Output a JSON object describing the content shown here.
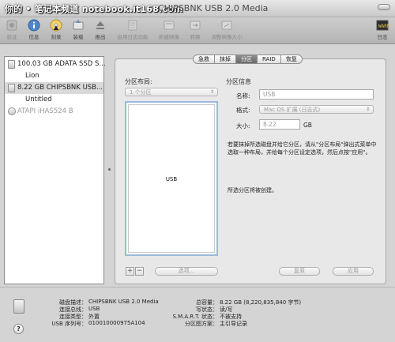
{
  "watermark": "你的 • 笔记本频道 notebook.it168.com",
  "window": {
    "title": "CHIPSBNK USB 2.0 Media"
  },
  "toolbar": {
    "items": [
      {
        "label": "验证",
        "icon": "verify-icon",
        "enabled": false
      },
      {
        "label": "信息",
        "icon": "info-icon",
        "enabled": true
      },
      {
        "label": "刻录",
        "icon": "burn-icon",
        "enabled": true
      },
      {
        "label": "装载",
        "icon": "mount-icon",
        "enabled": true
      },
      {
        "label": "推出",
        "icon": "eject-icon",
        "enabled": true
      },
      {
        "label": "启用日志功能",
        "icon": "journaling-icon",
        "enabled": false
      },
      {
        "label": "新建映像",
        "icon": "new-image-icon",
        "enabled": false
      },
      {
        "label": "转换",
        "icon": "convert-icon",
        "enabled": false
      },
      {
        "label": "调整映像大小",
        "icon": "resize-image-icon",
        "enabled": false
      }
    ],
    "log_label": "日志"
  },
  "sidebar": {
    "items": [
      {
        "label": "100.03 GB ADATA SSD S...",
        "type": "disk",
        "selected": false,
        "dim": false
      },
      {
        "label": "Lion",
        "type": "volume",
        "selected": false,
        "dim": false
      },
      {
        "label": "8.22 GB CHIPSBNK USB...",
        "type": "disk",
        "selected": true,
        "dim": false
      },
      {
        "label": "Untitled",
        "type": "volume",
        "selected": false,
        "dim": false
      },
      {
        "label": "ATAPI iHAS524 B",
        "type": "optical",
        "selected": false,
        "dim": true
      }
    ]
  },
  "tabs": [
    "急救",
    "抹掉",
    "分区",
    "RAID",
    "恢复"
  ],
  "active_tab": "分区",
  "partition": {
    "layout_title": "分区布局:",
    "layout_select": "1 个分区",
    "layout_box_label": "USB",
    "info_title": "分区信息",
    "name_label": "名称:",
    "name_value": "USB",
    "format_label": "格式:",
    "format_value": "Mac OS 扩展 (日志式)",
    "size_label": "大小:",
    "size_value": "8.22",
    "size_unit": "GB",
    "instructions": "若要抹掉所选磁盘并给它分区，请从\"分区布局\"弹出式菜单中选取一种布局，并给每个分区设定选项，然后点按\"应用\"。",
    "status": "所选分区将被创建。",
    "add_label": "+",
    "remove_label": "−",
    "options_label": "选项...",
    "revert_label": "复原",
    "apply_label": "应用"
  },
  "info": {
    "rows_left": [
      {
        "label": "磁盘描述：",
        "value": "CHIPSBNK USB 2.0 Media"
      },
      {
        "label": "连接总线：",
        "value": "USB"
      },
      {
        "label": "连接类型：",
        "value": "外置"
      },
      {
        "label": "USB 序列号：",
        "value": "010010000975A104"
      }
    ],
    "rows_right": [
      {
        "label": "总容量：",
        "value": "8.22 GB (8,220,835,840 字节)"
      },
      {
        "label": "写状态：",
        "value": "读/写"
      },
      {
        "label": "S.M.A.R.T. 状态：",
        "value": "不被支持"
      },
      {
        "label": "分区图方案：",
        "value": "主引导记录"
      }
    ]
  },
  "help_label": "?"
}
